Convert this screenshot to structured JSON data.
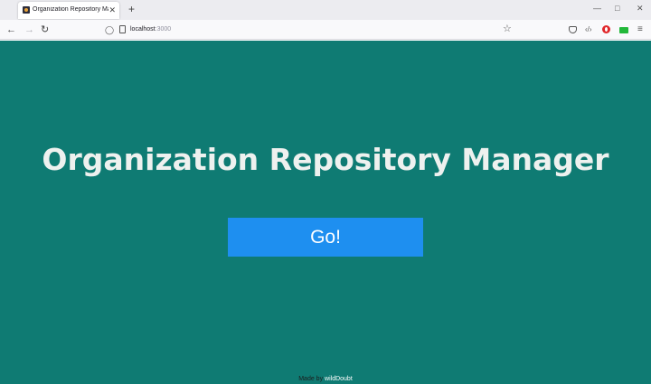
{
  "browser": {
    "tab": {
      "title": "Organization Repository Mana",
      "favicon": "app-favicon-icon"
    },
    "new_tab_symbol": "+",
    "tab_close_symbol": "✕",
    "window_controls": {
      "minimize": "—",
      "maximize": "□",
      "close": "✕"
    },
    "nav": {
      "back": "←",
      "forward": "→",
      "reload": "↻",
      "bookmark": "☆",
      "menu": "≡",
      "devtools": "‹/›"
    },
    "url": {
      "host": "localhost",
      "port": ":3000"
    }
  },
  "page": {
    "background_color": "#0f7b73",
    "title": "Organization Repository Manager",
    "go_button": {
      "label": "Go!",
      "color": "#1e8ff0"
    },
    "footer": {
      "prefix": "Made by",
      "author": "wildDoubt"
    }
  }
}
